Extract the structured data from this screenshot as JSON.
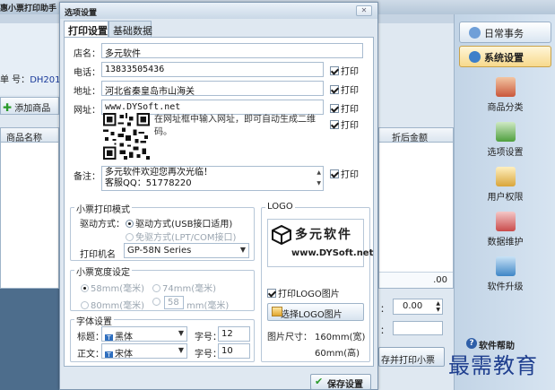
{
  "app": {
    "title": "惠小票打印助手",
    "order_label": "单 号：",
    "order_no": "DH201",
    "add_goods": "添加商品",
    "grid_col_name": "商品名称",
    "grid_col_discount": "折后金额",
    "grid_cell_value": ".00",
    "spin_value": "0.00",
    "colon": "：",
    "print_button": "存并打印小票"
  },
  "sidebar": {
    "tab_daily": "日常事务",
    "tab_settings": "系统设置",
    "items": [
      "商品分类",
      "选项设置",
      "用户权限",
      "数据维护",
      "软件升级"
    ],
    "help": "软件帮助"
  },
  "watermark": "最需教育",
  "dialog": {
    "title": "选项设置",
    "close": "✕",
    "tabs": [
      "打印设置",
      "基础数据"
    ],
    "fields": {
      "store_label": "店名：",
      "store_value": "多元软件",
      "phone_label": "电话：",
      "phone_value": "13833505436",
      "address_label": "地址：",
      "address_value": "河北省秦皇岛市山海关",
      "url_label": "网址：",
      "url_value": "www.DYSoft.net",
      "qr_note": "在网址框中输入网址，即可自动生成二维码。",
      "memo_label": "备注：",
      "memo_value": "多元软件欢迎您再次光临！\n客服QQ：51778220"
    },
    "print_checkbox": "打印",
    "ticket_mode": {
      "title": "小票打印模式",
      "drive_label": "驱动方式：",
      "opt_driver": "驱动方式(USB接口适用)",
      "opt_nodriver": "免驱方式(LPT/COM接口)",
      "printer_label": "打印机名",
      "printer_value": "GP-58N Series"
    },
    "width": {
      "title": "小票宽度设定",
      "opt_58": "58mm(毫米)",
      "opt_74": "74mm(毫米)",
      "opt_80": "80mm(毫米)",
      "custom_value": "58",
      "custom_unit": "mm(毫米)"
    },
    "font": {
      "title": "字体设置",
      "title_label": "标题：",
      "title_font": "黑体",
      "size_label": "字号：",
      "title_size": "12",
      "body_label": "正文：",
      "body_font": "宋体",
      "body_size": "10"
    },
    "logo": {
      "title": "LOGO",
      "brand": "多元软件",
      "url": "www.DYSoft.net",
      "print_logo": "打印LOGO图片",
      "choose_button": "选择LOGO图片",
      "size_label": "图片尺寸：",
      "size_width": "160mm(宽)",
      "size_height": "60mm(高)"
    },
    "save_button": "保存设置"
  }
}
